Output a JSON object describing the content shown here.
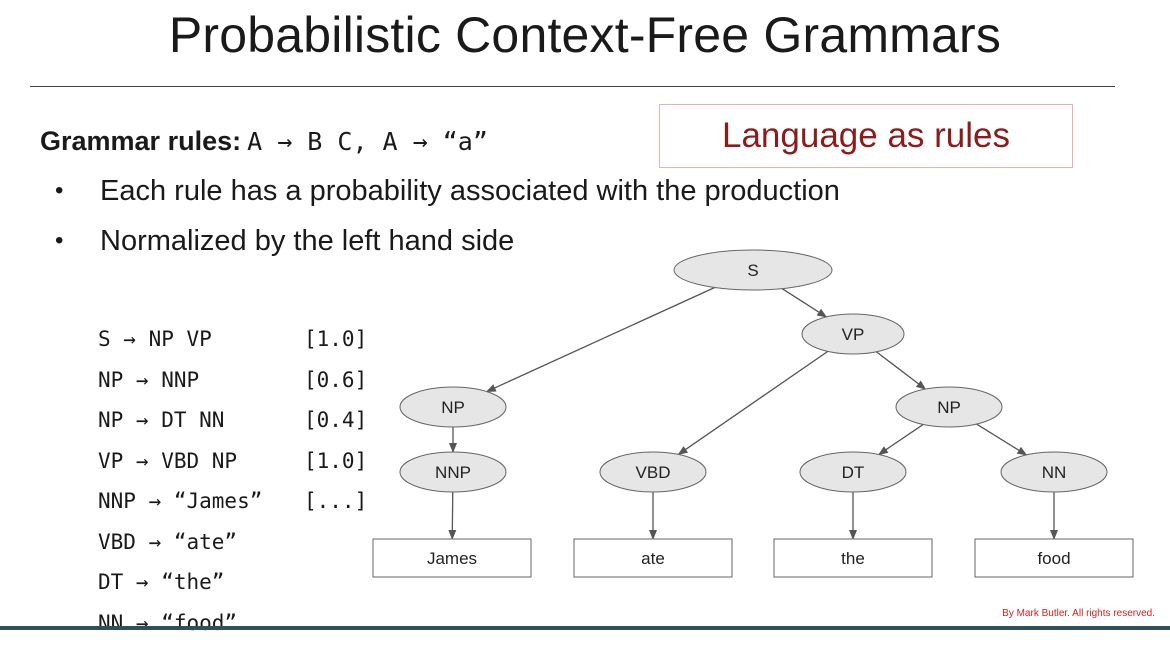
{
  "slide": {
    "title": "Probabilistic Context-Free Grammars",
    "rules_heading": {
      "label": "Grammar rules:",
      "formula": "A → B C, A → “a”"
    },
    "callout": "Language as rules",
    "bullets": [
      "Each rule has a probability associated with the production",
      "Normalized by the left hand side"
    ],
    "productions": [
      {
        "rule": "S → NP VP",
        "prob": "[1.0]"
      },
      {
        "rule": "NP → NNP",
        "prob": "[0.6]"
      },
      {
        "rule": "NP → DT NN",
        "prob": "[0.4]"
      },
      {
        "rule": "VP → VBD NP",
        "prob": "[1.0]"
      },
      {
        "rule": "NNP → “James”",
        "prob": "[...]"
      },
      {
        "rule": "VBD → “ate”",
        "prob": ""
      },
      {
        "rule": "DT → “the”",
        "prob": ""
      },
      {
        "rule": "NN → “food”",
        "prob": ""
      }
    ],
    "tree": {
      "nodes": [
        {
          "id": "S",
          "label": "S",
          "kind": "nonterminal"
        },
        {
          "id": "VP",
          "label": "VP",
          "kind": "nonterminal"
        },
        {
          "id": "NP1",
          "label": "NP",
          "kind": "nonterminal"
        },
        {
          "id": "NP2",
          "label": "NP",
          "kind": "nonterminal"
        },
        {
          "id": "NNP",
          "label": "NNP",
          "kind": "nonterminal"
        },
        {
          "id": "VBD",
          "label": "VBD",
          "kind": "nonterminal"
        },
        {
          "id": "DT",
          "label": "DT",
          "kind": "nonterminal"
        },
        {
          "id": "NN",
          "label": "NN",
          "kind": "nonterminal"
        },
        {
          "id": "w1",
          "label": "James",
          "kind": "terminal"
        },
        {
          "id": "w2",
          "label": "ate",
          "kind": "terminal"
        },
        {
          "id": "w3",
          "label": "the",
          "kind": "terminal"
        },
        {
          "id": "w4",
          "label": "food",
          "kind": "terminal"
        }
      ],
      "edges": [
        [
          "S",
          "NP1"
        ],
        [
          "S",
          "VP"
        ],
        [
          "VP",
          "VBD"
        ],
        [
          "VP",
          "NP2"
        ],
        [
          "NP1",
          "NNP"
        ],
        [
          "NP2",
          "DT"
        ],
        [
          "NP2",
          "NN"
        ],
        [
          "NNP",
          "w1"
        ],
        [
          "VBD",
          "w2"
        ],
        [
          "DT",
          "w3"
        ],
        [
          "NN",
          "w4"
        ]
      ]
    },
    "credit": "By Mark Butler. All rights reserved.",
    "colors": {
      "callout_text": "#8b1c1c",
      "callout_border": "#e8b3b3",
      "node_fill": "#e6e6e6",
      "credit": "#d42020"
    }
  }
}
